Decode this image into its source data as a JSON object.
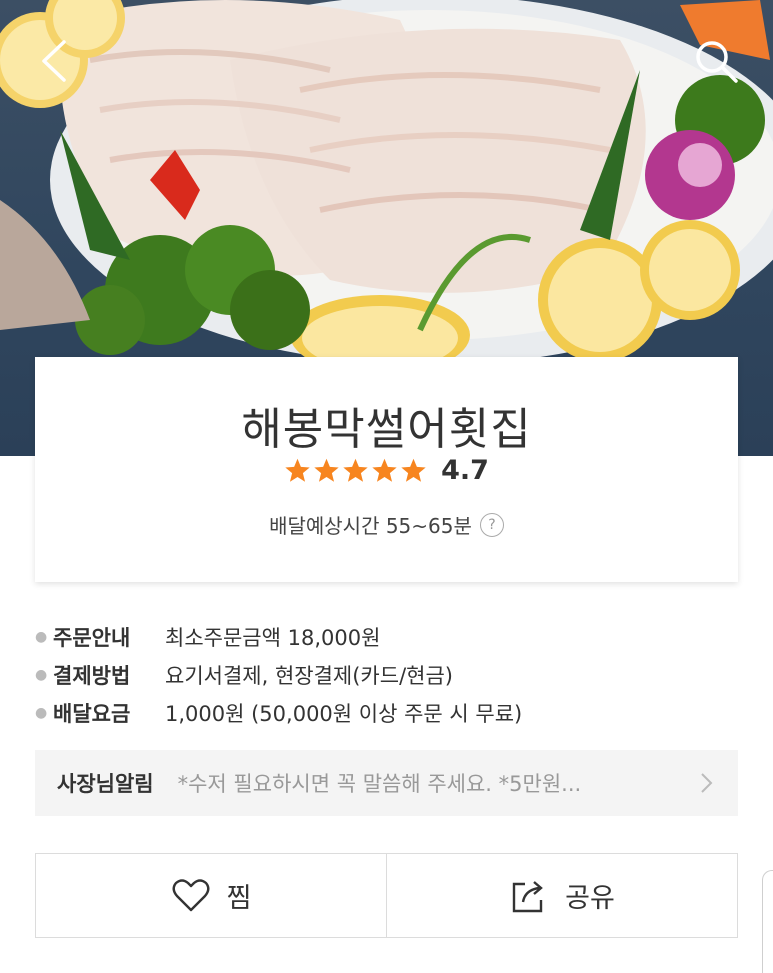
{
  "store": {
    "name": "해봉막썰어횟집",
    "rating": "4.7",
    "rating_stars": 5,
    "delivery_time": "배달예상시간 55~65분",
    "help_symbol": "?"
  },
  "info": [
    {
      "label": "주문안내",
      "value": "최소주문금액 18,000원"
    },
    {
      "label": "결제방법",
      "value": "요기서결제, 현장결제(카드/현금)"
    },
    {
      "label": "배달요금",
      "value": "1,000원 (50,000원 이상 주문 시 무료)"
    }
  ],
  "notice": {
    "label": "사장님알림",
    "text": "*수저 필요하시면  꼭 말씀해 주세요. *5만원..."
  },
  "actions": {
    "like_label": "찜",
    "share_label": "공유"
  },
  "colors": {
    "star": "#f7851f",
    "text": "#333333",
    "muted": "#999999"
  },
  "icons": {
    "back": "back-arrow-icon",
    "search": "search-icon",
    "help": "question-circle-icon",
    "notice_arrow": "chevron-right-icon",
    "like": "heart-icon",
    "share": "share-icon"
  }
}
